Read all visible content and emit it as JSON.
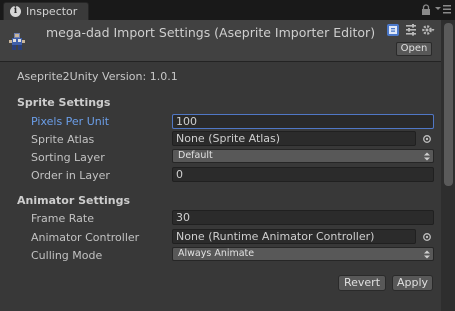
{
  "tab": {
    "label": "Inspector"
  },
  "header": {
    "title": "mega-dad Import Settings (Aseprite Importer Editor)",
    "open_label": "Open"
  },
  "version_text": "Aseprite2Unity Version: 1.0.1",
  "sprite_settings": {
    "title": "Sprite Settings",
    "pixels_per_unit": {
      "label": "Pixels Per Unit",
      "value": "100"
    },
    "sprite_atlas": {
      "label": "Sprite Atlas",
      "value": "None (Sprite Atlas)"
    },
    "sorting_layer": {
      "label": "Sorting Layer",
      "value": "Default"
    },
    "order_in_layer": {
      "label": "Order in Layer",
      "value": "0"
    }
  },
  "animator_settings": {
    "title": "Animator Settings",
    "frame_rate": {
      "label": "Frame Rate",
      "value": "30"
    },
    "animator_controller": {
      "label": "Animator Controller",
      "value": "None (Runtime Animator Controller)"
    },
    "culling_mode": {
      "label": "Culling Mode",
      "value": "Always Animate"
    }
  },
  "buttons": {
    "revert": "Revert",
    "apply": "Apply"
  },
  "colors": {
    "background": "#383838",
    "header": "#414141",
    "field": "#2b2b2b",
    "focus": "#5077c5",
    "active_label": "#6b9ee8"
  }
}
